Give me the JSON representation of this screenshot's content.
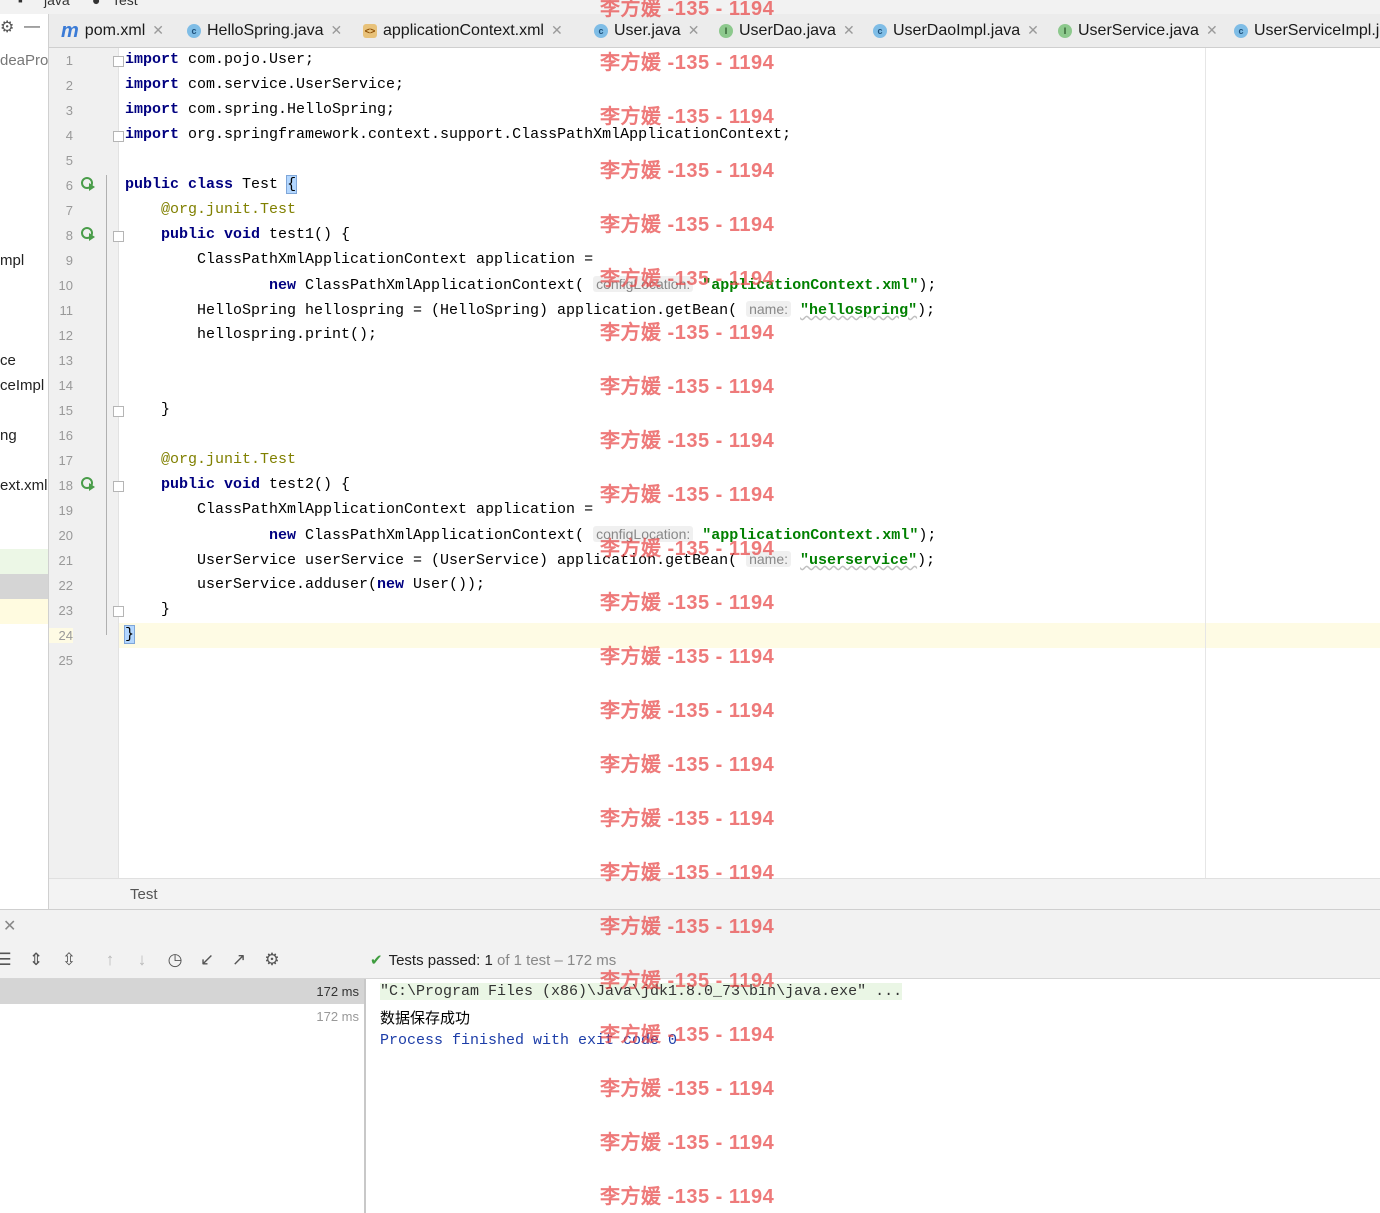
{
  "breadcrumb": {
    "items": [
      "java",
      "Test"
    ]
  },
  "left_pane": {
    "fragments": [
      "deaPro",
      "mpl",
      "ce",
      "ceImpl",
      "ng",
      "ext.xml"
    ]
  },
  "tabs": [
    {
      "label": "pom.xml",
      "icon": "maven-icon"
    },
    {
      "label": "HelloSpring.java",
      "icon": "class-icon"
    },
    {
      "label": "applicationContext.xml",
      "icon": "xml-spring-icon"
    },
    {
      "label": "User.java",
      "icon": "class-icon"
    },
    {
      "label": "UserDao.java",
      "icon": "interface-icon"
    },
    {
      "label": "UserDaoImpl.java",
      "icon": "class-icon"
    },
    {
      "label": "UserService.java",
      "icon": "interface-icon"
    },
    {
      "label": "UserServiceImpl.j",
      "icon": "class-icon"
    }
  ],
  "editor": {
    "line_numbers": [
      "1",
      "2",
      "3",
      "4",
      "5",
      "6",
      "7",
      "8",
      "9",
      "10",
      "11",
      "12",
      "13",
      "14",
      "15",
      "16",
      "17",
      "18",
      "19",
      "20",
      "21",
      "22",
      "23",
      "24",
      "25"
    ],
    "current_line": "24",
    "code": {
      "l1_kw": "import",
      "l1_rest": " com.pojo.User;",
      "l2_kw": "import",
      "l2_rest": " com.service.UserService;",
      "l3_kw": "import",
      "l3_rest": " com.spring.HelloSpring;",
      "l4_kw": "import",
      "l4_rest": " org.springframework.context.support.ClassPathXmlApplicationContext;",
      "l6_kw1": "public",
      "l6_kw2": "class",
      "l6_name": " Test ",
      "l6_brace": "{",
      "l7_at": "@org.junit.",
      "l7_ann": "Test",
      "l8_kw1": "public",
      "l8_kw2": "void",
      "l8_rest": " test1() {",
      "l9": "ClassPathXmlApplicationContext application =",
      "l10_kw": "new",
      "l10_rest": " ClassPathXmlApplicationContext(",
      "l10_hint": "configLocation:",
      "l10_str": "\"applicationContext.xml\"",
      "l10_end": ");",
      "l11": "HelloSpring hellospring = (HelloSpring) application.getBean(",
      "l11_hint": "name:",
      "l11_str": "\"hellospring\"",
      "l11_end": ");",
      "l12": "hellospring.print();",
      "l15": "}",
      "l17_at": "@org.junit.",
      "l17_ann": "Test",
      "l18_kw1": "public",
      "l18_kw2": "void",
      "l18_rest": " test2() {",
      "l19": "ClassPathXmlApplicationContext application =",
      "l20_kw": "new",
      "l20_rest": " ClassPathXmlApplicationContext(",
      "l20_hint": "configLocation:",
      "l20_str": "\"applicationContext.xml\"",
      "l20_end": ");",
      "l21": "UserService userService = (UserService) application.getBean(",
      "l21_hint": "name:",
      "l21_str": "\"userservice\"",
      "l21_end": ");",
      "l22_a": "userService.adduser(",
      "l22_kw": "new",
      "l22_b": " User());",
      "l23": "}",
      "l24": "}"
    }
  },
  "editor_breadcrumb": "Test",
  "run_panel": {
    "status_prefix": "Tests passed:",
    "status_count": "1",
    "status_suffix": "of 1 test – 172 ms",
    "tree_rows": [
      {
        "time": "172 ms"
      },
      {
        "time": "172 ms"
      }
    ],
    "console": {
      "line1": "\"C:\\Program Files (x86)\\Java\\jdk1.8.0_73\\bin\\java.exe\" ...",
      "line2": "数据保存成功",
      "line3": "Process finished with exit code 0"
    }
  },
  "watermark": {
    "text": "李方媛 -135 - 1194",
    "color": "#e84646"
  },
  "colors": {
    "keyword": "#000080",
    "string": "#008000",
    "annotation": "#808000",
    "current_line": "#fefbe4"
  }
}
